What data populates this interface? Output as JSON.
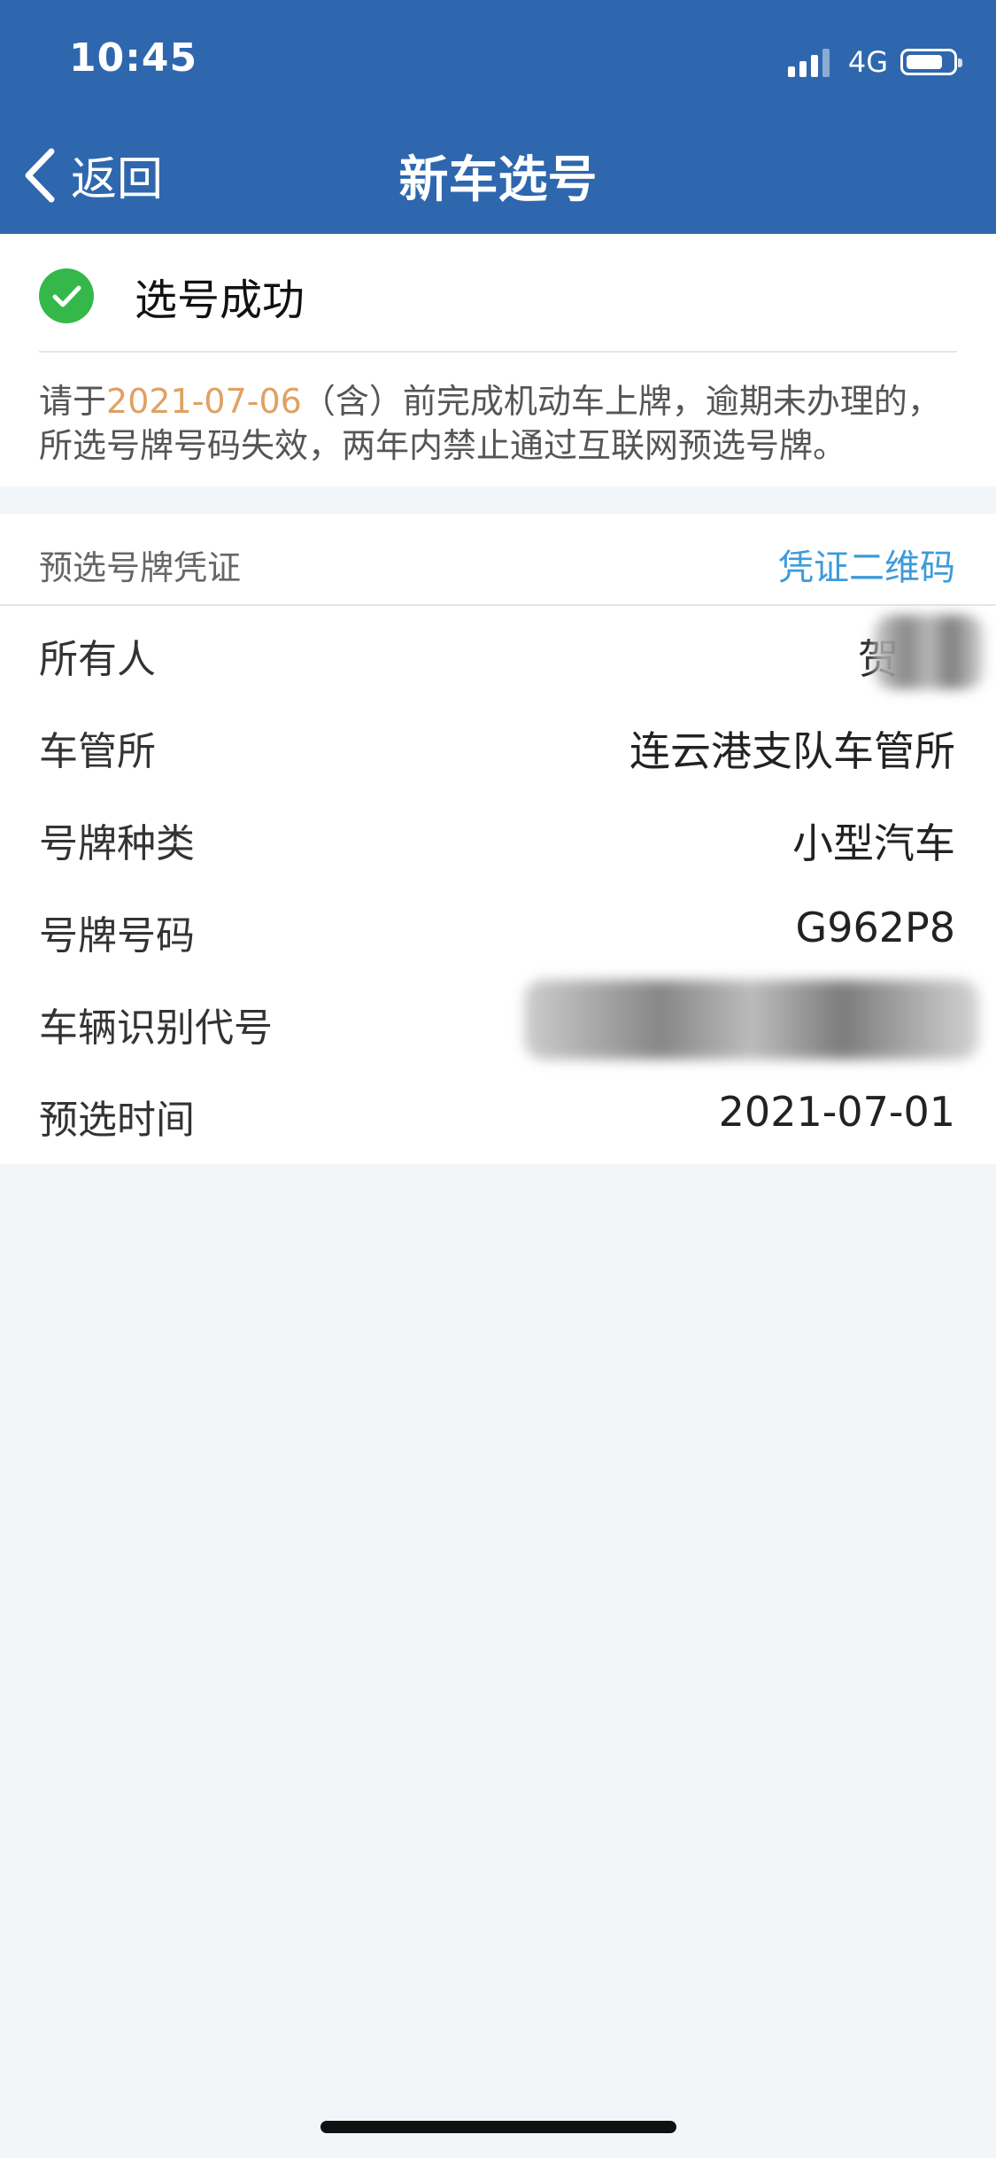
{
  "status": {
    "time": "10:45",
    "network": "4G"
  },
  "nav": {
    "back_label": "返回",
    "title": "新车选号"
  },
  "result": {
    "success_text": "选号成功",
    "notice_prefix": "请于",
    "notice_date": "2021-07-06",
    "notice_suffix": "（含）前完成机动车上牌，逾期未办理的，所选号牌号码失效，两年内禁止通过互联网预选号牌。"
  },
  "voucher": {
    "section_title": "预选号牌凭证",
    "qr_link": "凭证二维码",
    "rows": [
      {
        "label": "所有人",
        "value": "贺"
      },
      {
        "label": "车管所",
        "value": "连云港支队车管所"
      },
      {
        "label": "号牌种类",
        "value": "小型汽车"
      },
      {
        "label": "号牌号码",
        "value": "G962P8"
      },
      {
        "label": "车辆识别代号",
        "value": ""
      },
      {
        "label": "预选时间",
        "value": "2021-07-01"
      }
    ]
  },
  "colors": {
    "header": "#2e67ae",
    "accent_date": "#e0a163",
    "link": "#3d9bdb",
    "success": "#35b84a"
  },
  "icons": {
    "back": "chevron-left-icon",
    "success": "check-circle-icon"
  }
}
